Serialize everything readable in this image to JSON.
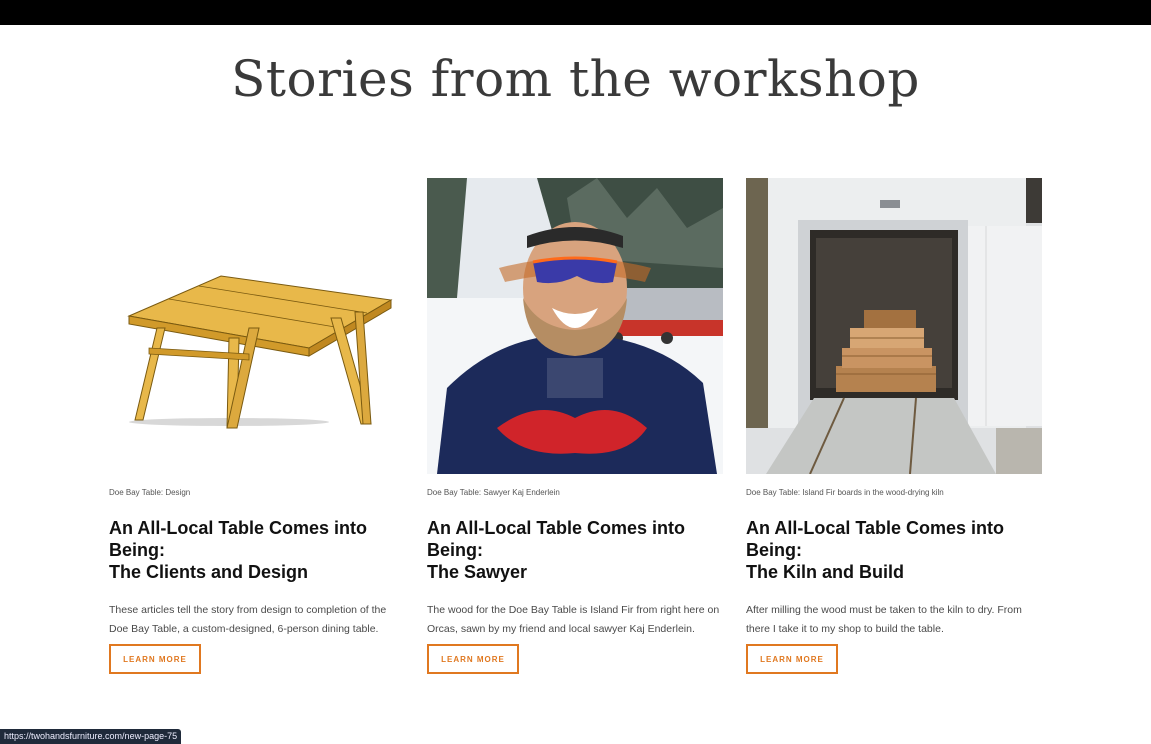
{
  "page": {
    "title": "Stories from the workshop"
  },
  "cards": [
    {
      "image_alt": "table-design-render",
      "caption": "Doe Bay Table: Design",
      "title_line1": "An All-Local Table Comes into Being:",
      "title_line2": "The Clients and Design",
      "desc": "These articles tell the story from design to completion of the Doe Bay Table, a custom-designed, 6-person dining table.",
      "button": "LEARN MORE"
    },
    {
      "image_alt": "sawyer-selfie-photo",
      "caption": "Doe Bay Table: Sawyer Kaj Enderlein",
      "title_line1": "An All-Local Table Comes into Being:",
      "title_line2": "The Sawyer",
      "desc": "The wood for the Doe Bay Table is Island Fir from right here on Orcas, sawn by my friend and local sawyer Kaj Enderlein.",
      "button": "LEARN MORE"
    },
    {
      "image_alt": "wood-drying-kiln-photo",
      "caption": "Doe Bay Table: Island Fir boards in the wood-drying kiln",
      "title_line1": "An All-Local Table Comes into Being:",
      "title_line2": "The Kiln and Build",
      "desc": "After milling the wood must be taken to the kiln to dry. From there I take it to my shop to build the table.",
      "button": "LEARN MORE"
    }
  ],
  "status_bar": {
    "url": "https://twohandsfurniture.com/new-page-75"
  },
  "colors": {
    "accent": "#e07820",
    "topbar": "#000000",
    "title": "#3a3a3a"
  }
}
